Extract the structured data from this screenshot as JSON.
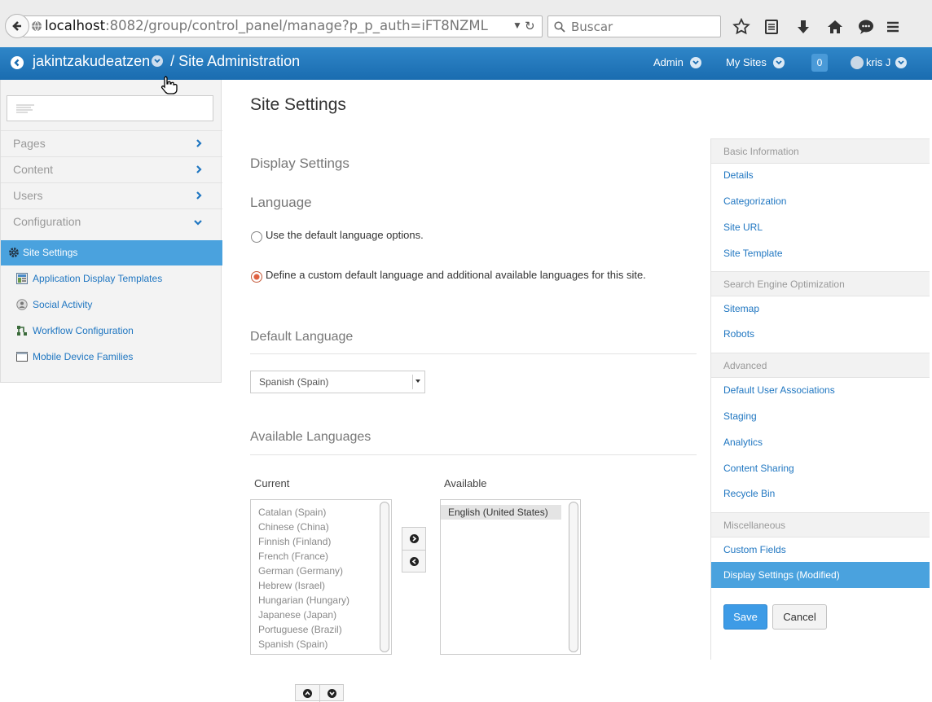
{
  "browser": {
    "url_host": "localhost",
    "url_rest": ":8082/group/control_panel/manage?p_p_auth=iFT8NZML",
    "search_placeholder": "Buscar"
  },
  "dockbar": {
    "site_name": "jakintzakudeatzen",
    "separator": " / ",
    "section": "Site Administration",
    "admin": "Admin",
    "my_sites": "My Sites",
    "notifications": "0",
    "user": "kris J"
  },
  "sidebar": {
    "sections": [
      {
        "label": "Pages"
      },
      {
        "label": "Content"
      },
      {
        "label": "Users"
      },
      {
        "label": "Configuration"
      }
    ],
    "items": [
      {
        "label": "Site Settings",
        "icon": "gear-icon",
        "active": true
      },
      {
        "label": "Application Display Templates",
        "icon": "template-icon"
      },
      {
        "label": "Social Activity",
        "icon": "social-icon"
      },
      {
        "label": "Workflow Configuration",
        "icon": "workflow-icon"
      },
      {
        "label": "Mobile Device Families",
        "icon": "mobile-device-icon"
      }
    ]
  },
  "main": {
    "title": "Site Settings",
    "display_settings": "Display Settings",
    "language_heading": "Language",
    "radio_default": "Use the default language options.",
    "radio_custom": "Define a custom default language and additional available languages for this site.",
    "default_language_heading": "Default Language",
    "default_language_value": "Spanish (Spain)",
    "available_languages_heading": "Available Languages",
    "current_label": "Current",
    "available_label": "Available",
    "current_languages": [
      "Catalan (Spain)",
      "Chinese (China)",
      "Finnish (Finland)",
      "French (France)",
      "German (Germany)",
      "Hebrew (Israel)",
      "Hungarian (Hungary)",
      "Japanese (Japan)",
      "Portuguese (Brazil)",
      "Spanish (Spain)"
    ],
    "available_languages": [
      "English (United States)"
    ]
  },
  "right_nav": {
    "basic_information": "Basic Information",
    "details": "Details",
    "categorization": "Categorization",
    "site_url": "Site URL",
    "site_template": "Site Template",
    "seo": "Search Engine Optimization",
    "sitemap": "Sitemap",
    "robots": "Robots",
    "advanced": "Advanced",
    "default_user_associations": "Default User Associations",
    "staging": "Staging",
    "analytics": "Analytics",
    "content_sharing": "Content Sharing",
    "recycle_bin": "Recycle Bin",
    "miscellaneous": "Miscellaneous",
    "custom_fields": "Custom Fields",
    "display_settings": "Display Settings (Modified)",
    "save": "Save",
    "cancel": "Cancel"
  },
  "colors": {
    "dockbar": "#1f74b8",
    "active_item": "#4aa2de",
    "link": "#1f76c1",
    "save_button": "#3d9be6"
  }
}
